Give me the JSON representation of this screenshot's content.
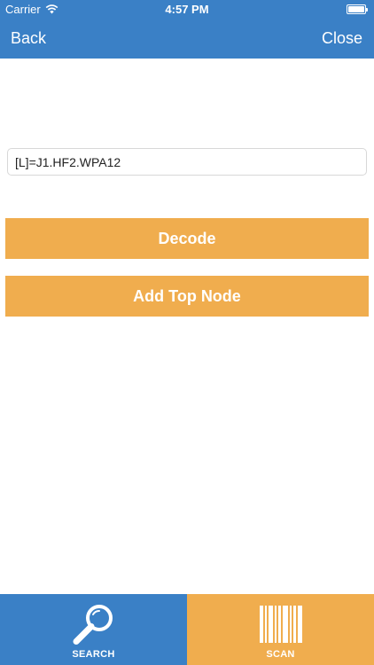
{
  "status_bar": {
    "carrier": "Carrier",
    "time": "4:57 PM"
  },
  "nav": {
    "back_label": "Back",
    "close_label": "Close"
  },
  "form": {
    "code_value": "[L]=J1.HF2.WPA12",
    "decode_label": "Decode",
    "add_top_node_label": "Add Top Node"
  },
  "tabs": [
    {
      "label": "SEARCH",
      "icon": "search-icon",
      "active": false
    },
    {
      "label": "SCAN",
      "icon": "barcode-icon",
      "active": true
    }
  ],
  "colors": {
    "header_blue": "#3a80c6",
    "button_orange": "#f0ad4e"
  }
}
